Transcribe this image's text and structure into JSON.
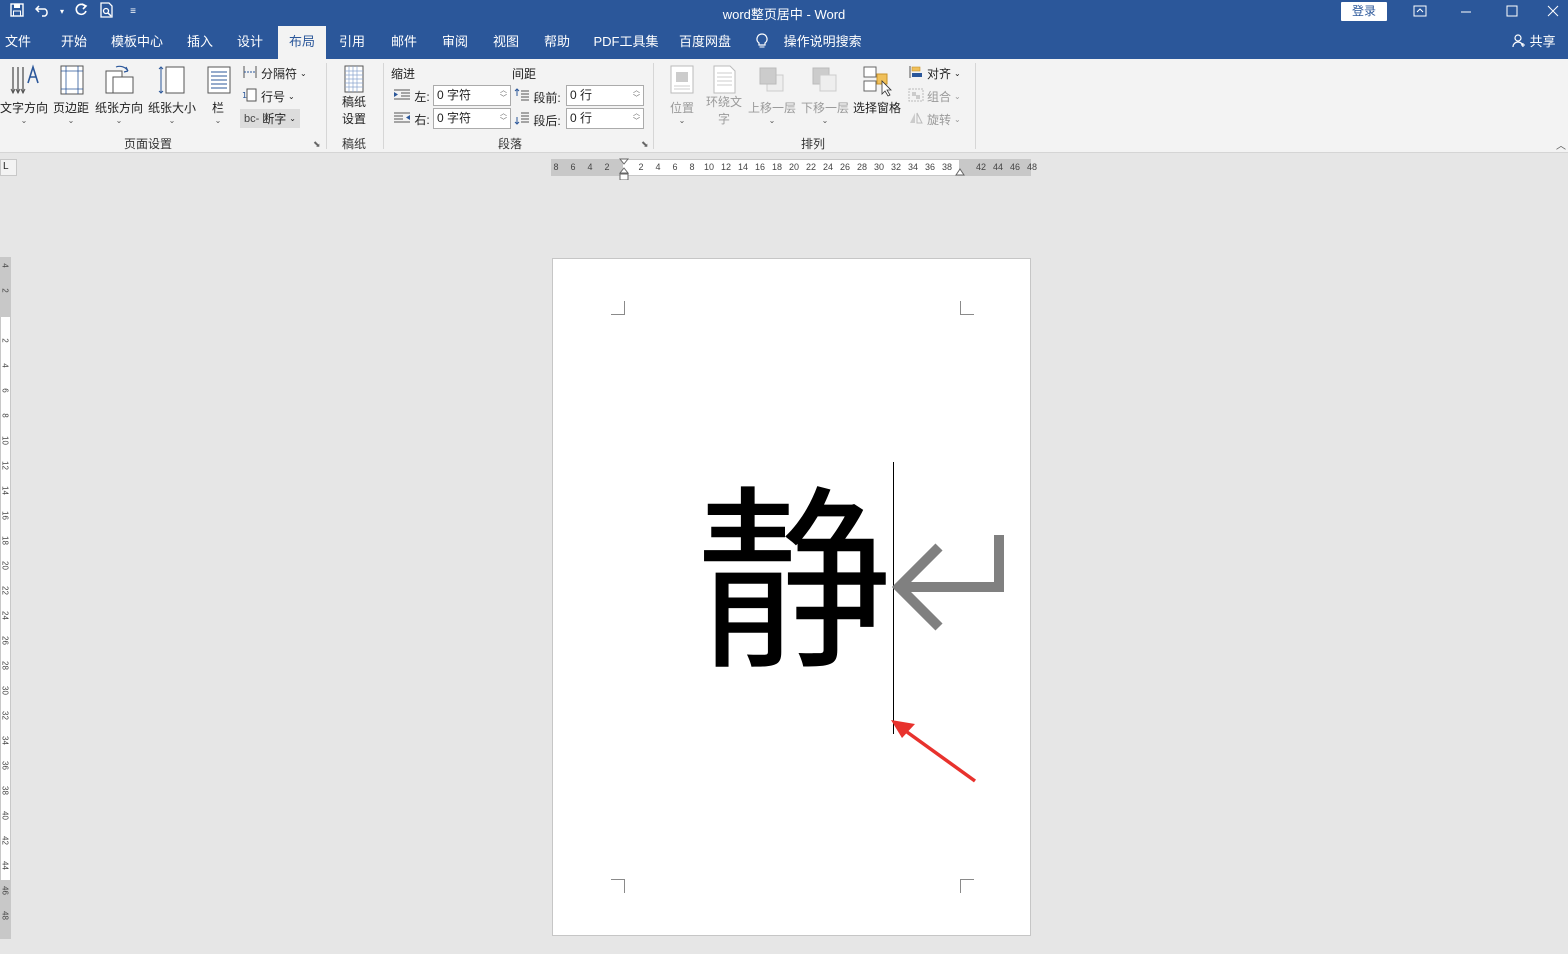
{
  "window": {
    "title": "word整页居中  -  Word",
    "login_label": "登录",
    "controls": [
      "restore-ribbon",
      "minimize",
      "maximize",
      "close"
    ]
  },
  "quick_access": [
    "save-icon",
    "undo-icon",
    "redo-icon",
    "print-preview-icon",
    "customize-icon"
  ],
  "tabs": [
    {
      "label": "文件"
    },
    {
      "label": "开始"
    },
    {
      "label": "模板中心"
    },
    {
      "label": "插入"
    },
    {
      "label": "设计"
    },
    {
      "label": "布局",
      "active": true
    },
    {
      "label": "引用"
    },
    {
      "label": "邮件"
    },
    {
      "label": "审阅"
    },
    {
      "label": "视图"
    },
    {
      "label": "帮助"
    },
    {
      "label": "PDF工具集"
    },
    {
      "label": "百度网盘"
    }
  ],
  "tell_me": "操作说明搜索",
  "share_label": "共享",
  "ribbon": {
    "page_setup": {
      "label": "页面设置",
      "text_direction": "文字方向",
      "margins": "页边距",
      "orientation": "纸张方向",
      "size": "纸张大小",
      "columns": "栏",
      "breaks": "分隔符",
      "line_numbers": "行号",
      "hyphenation": "断字"
    },
    "manuscript": {
      "label": "稿纸",
      "button_line1": "稿纸",
      "button_line2": "设置"
    },
    "paragraph": {
      "label": "段落",
      "indent_title": "缩进",
      "spacing_title": "间距",
      "left_label": "左:",
      "right_label": "右:",
      "left_value": "0 字符",
      "right_value": "0 字符",
      "before_label": "段前:",
      "after_label": "段后:",
      "before_value": "0 行",
      "after_value": "0 行"
    },
    "arrange": {
      "label": "排列",
      "position": "位置",
      "wrap_line1": "环绕文",
      "wrap_line2": "字",
      "bring_forward": "上移一层",
      "send_backward": "下移一层",
      "selection_pane": "选择窗格",
      "align": "对齐",
      "group": "组合",
      "rotate": "旋转"
    }
  },
  "ruler": {
    "horizontal_ticks": [
      "8",
      "6",
      "4",
      "2",
      "2",
      "4",
      "6",
      "8",
      "10",
      "12",
      "14",
      "16",
      "18",
      "20",
      "22",
      "24",
      "26",
      "28",
      "30",
      "32",
      "34",
      "36",
      "38",
      "42",
      "44",
      "46",
      "48"
    ],
    "vertical_ticks": [
      "4",
      "2",
      "2",
      "4",
      "6",
      "8",
      "10",
      "12",
      "14",
      "16",
      "18",
      "20",
      "22",
      "24",
      "26",
      "28",
      "30",
      "32",
      "34",
      "36",
      "38",
      "40",
      "42",
      "44",
      "46",
      "48"
    ],
    "corner": "L"
  },
  "document": {
    "text": "静"
  },
  "colors": {
    "accent": "#2b579a",
    "annotation_arrow": "#e8322d",
    "paragraph_mark": "#808080"
  }
}
